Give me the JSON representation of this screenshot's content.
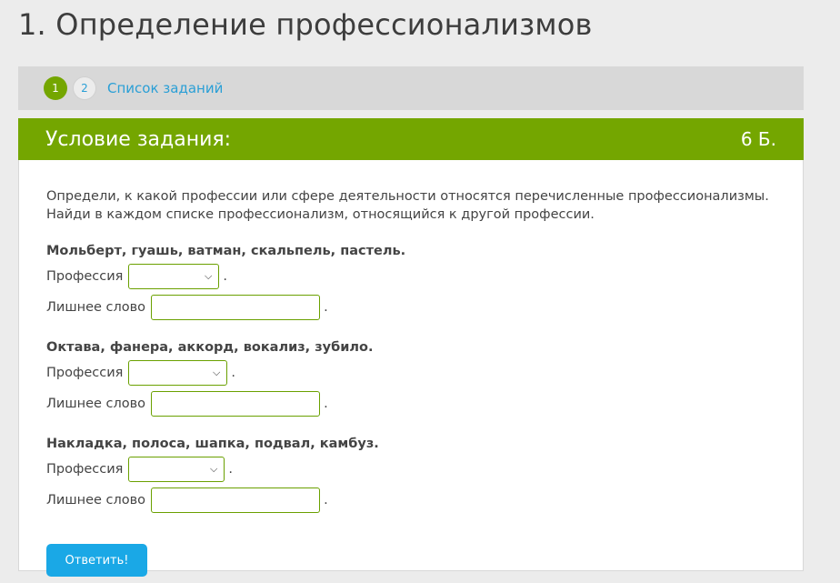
{
  "page": {
    "title": "1. Определение профессионализмов"
  },
  "steps": {
    "items": [
      {
        "label": "1",
        "active": true
      },
      {
        "label": "2",
        "active": false
      }
    ],
    "task_list_link": "Список заданий"
  },
  "task": {
    "header_title": "Условие задания:",
    "points": "6 Б.",
    "instruction": "Определи, к какой профессии или сфере деятельности относятся перечисленные профессионализмы. Найди в каждом списке профессионализм, относящийся к другой профессии.",
    "profession_label": "Профессия",
    "extra_word_label": "Лишнее слово",
    "groups": [
      {
        "title": "Мольберт, гуашь, ватман, скальпель, пастель.",
        "profession_value": "",
        "extra_word_value": ""
      },
      {
        "title": "Октава, фанера, аккорд, вокализ, зубило.",
        "profession_value": "",
        "extra_word_value": ""
      },
      {
        "title": "Накладка, полоса, шапка, подвал, камбуз.",
        "profession_value": "",
        "extra_word_value": ""
      }
    ],
    "submit_label": "Ответить!"
  },
  "colors": {
    "accent_green": "#74a600",
    "link_blue": "#2a9fd6",
    "button_blue": "#1aa8e6"
  },
  "icons": {
    "dropdown": "chevron-down-icon"
  }
}
